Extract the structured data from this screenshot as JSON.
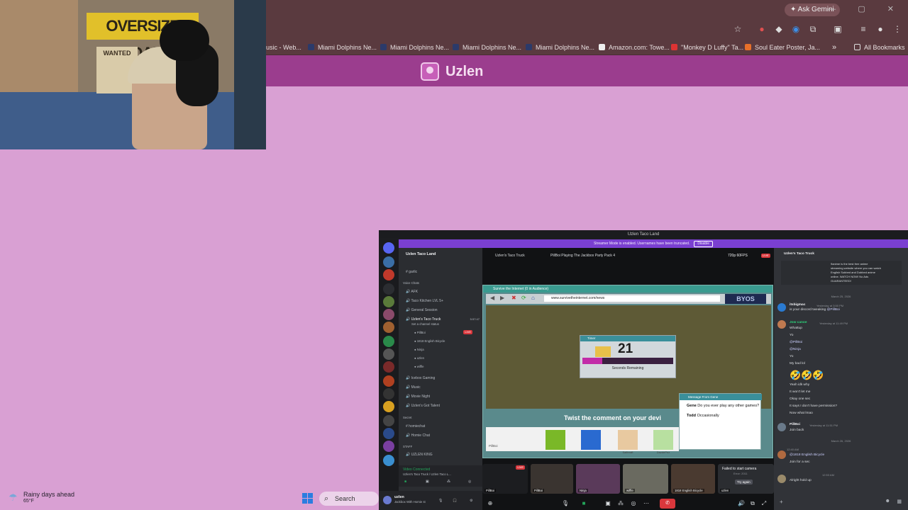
{
  "browser": {
    "gemini_label": "Ask Gemini",
    "window_controls": "— ▢ ✕",
    "bookmarks": [
      {
        "label": "usic - Web..."
      },
      {
        "label": "Miami Dolphins Ne..."
      },
      {
        "label": "Miami Dolphins Ne..."
      },
      {
        "label": "Miami Dolphins Ne..."
      },
      {
        "label": "Miami Dolphins Ne..."
      },
      {
        "label": "Amazon.com: Towe..."
      },
      {
        "label": "\"Monkey D Luffy\" Ta..."
      },
      {
        "label": "Soul Eater Poster, Ja..."
      }
    ],
    "more_bookmarks": "»",
    "all_bookmarks": "All Bookmarks"
  },
  "site": {
    "title": "Uzlen"
  },
  "webcam": {
    "banner_text": "OVERSIZE LOAD",
    "poster_text": "WANTED"
  },
  "taskbar": {
    "weather_title": "Rainy days ahead",
    "weather_temp": "65°F",
    "search_label": "Search"
  },
  "discord": {
    "window_title": "Uzlen Taco Land",
    "streamer_mode": "Streamer Mode is enabled. Usernames have been truncated.",
    "disable_label": "Disable",
    "server_name": "Uzlen Taco Land",
    "channels": {
      "text1": "garlic",
      "voice_category": "Voice Chats",
      "afk": "AFK",
      "taco_kitchen": "Taco Kitchen LVL 5+",
      "general_session": "General Session",
      "taco_truck": "Uzlen's Taco Truck",
      "taco_truck_status": "Set a channel status",
      "taco_truck_time": "5:57:47",
      "members": [
        "PillBoi",
        "1818 English Bicycle",
        "Ninja",
        "uzlen",
        "wiffle"
      ],
      "live": "LIVE",
      "icebox": "Icebox Gaming",
      "music": "Music",
      "movie_night": "Movie Night",
      "got_talent": "Uzlen's Got Talent",
      "secret_category": "Secret",
      "homiechat": "homiechat",
      "homie_chat": "Homie Chat",
      "staff_category": "STAFF",
      "uzlen_king": "UZLEN KING"
    },
    "voice": {
      "status": "Video Connected",
      "sub": "Uzlen's Taco Truck / Uzlen Taco L..."
    },
    "user": {
      "name": "uzlen",
      "activity": "Jackbox With Homie st"
    },
    "stream": {
      "channel": "Uzlen's Taco Truck",
      "activity": "PillBoi Playing The Jackbox Party Pack 4",
      "quality": "720p 60FPS",
      "live": "LIVE"
    },
    "game": {
      "window_title": "Survive the Internet (0 in Audience)",
      "url": "www.survivetheinternet.com/news",
      "brand": "BYOS",
      "timer_title": "Timer",
      "timer_value": "21",
      "timer_fraction": 0.22,
      "timer_label": "Seconds Remaining",
      "msg_title": "Message From Gene",
      "msg_line1_name": "Gene",
      "msg_line1": "Do you ever play any other games?",
      "msg_line2_name": "Todd",
      "msg_line2": "Occasionally",
      "prompt": "Twist the comment on your devi",
      "tray_name": "PillBoi",
      "tokens": [
        "",
        "",
        "Safferaft",
        "DazdePez"
      ]
    },
    "tiles": [
      {
        "name": "PillBoi",
        "tag": "LIVE"
      },
      {
        "name": "PillBoi"
      },
      {
        "name": "Ninja"
      },
      {
        "name": "wiffle"
      },
      {
        "name": "1818 English Bicycle"
      },
      {
        "name": "uzlen",
        "error": "Failed to start camera",
        "error_sub": "Error: 2011",
        "retry": "Try again"
      }
    ],
    "chat": {
      "channel": "Uzlen's Taco Truck",
      "pinned": [
        "9anime is the best free anime",
        "streaming website where you can watch",
        "English Subbed and Dubbed anime",
        "online. WATCH NOW! No Ads",
        "GUARANTEED!"
      ],
      "date1": "March 25, 2026",
      "m1_name": "itsbigmac",
      "m1_meta": "Yesterday at 3:50 PM",
      "m1_text": "is your discord tweaking",
      "m1_mention": "@PillBoi",
      "m2_name": "Jow canoe",
      "m2_meta": "Yesterday at 11:49 PM",
      "m2_lines": [
        "Whattup",
        "Yo",
        "@PillBoi",
        "@Ninja",
        "Yo",
        "My bad lol",
        "🤣🤣🤣",
        "Yeah idk why",
        "It won't let me",
        "Okay one sec",
        "It says I don't have permission?",
        "Now what lmao"
      ],
      "m3_name": "PillBoi",
      "m3_meta": "Yesterday at 11:51 PM",
      "m3_text": "Join back",
      "date2": "March 26, 2026",
      "m4_time": "12:40 AM",
      "m4_mention": "@1818 English Bicycle",
      "m4_text": "Join for a sec",
      "m5_time": "12:53 AM",
      "m5_text": "Alright hold up"
    }
  }
}
